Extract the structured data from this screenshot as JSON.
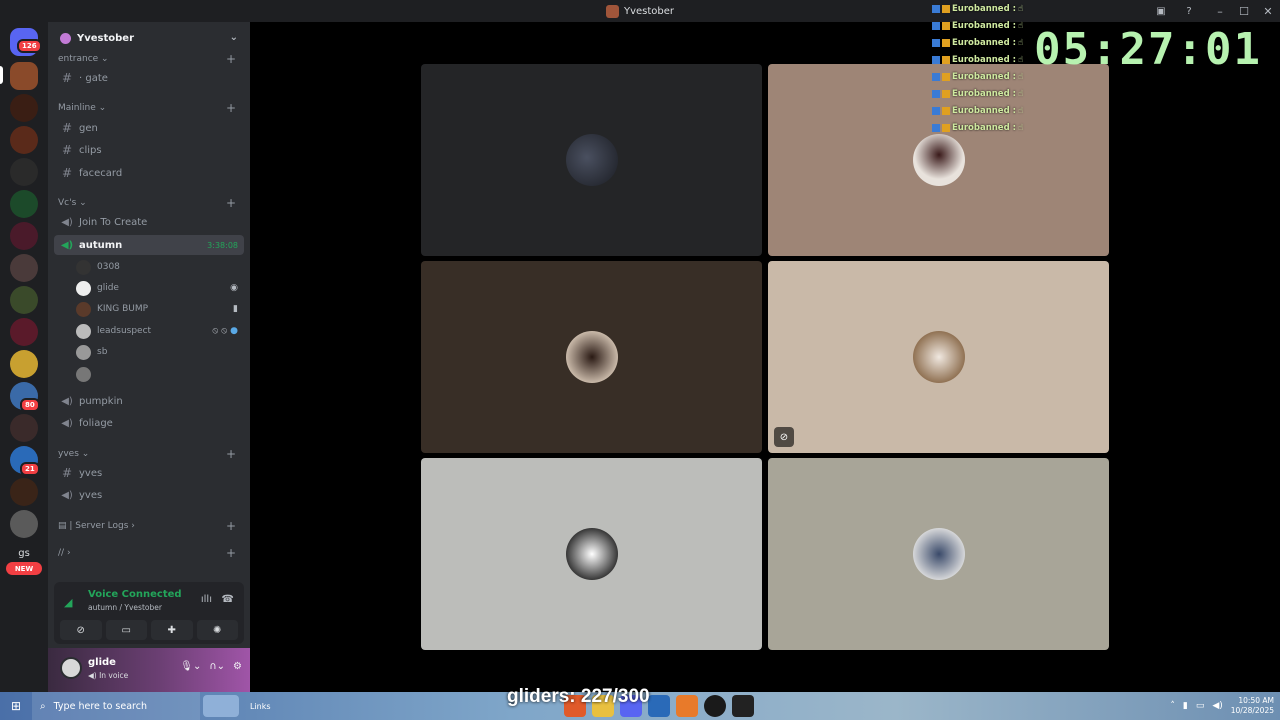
{
  "window": {
    "title": "Yvestober"
  },
  "rail": {
    "home_badge": "126",
    "badges": [
      "80",
      "21"
    ],
    "gs_label": "gs",
    "new_label": "NEW"
  },
  "guild": {
    "name": "Yvestober"
  },
  "categories": {
    "entrance": "entrance",
    "mainline": "Mainline",
    "vcs": "Vc's",
    "yves": "yves",
    "server_logs": "| Server Logs",
    "slashes": "//"
  },
  "channels": {
    "gate": "gate",
    "gen": "gen",
    "clips": "clips",
    "facecard": "facecard",
    "join_to_create": "Join To Create",
    "autumn": "autumn",
    "autumn_timer": "3:38:08",
    "pumpkin": "pumpkin",
    "foliage": "foliage",
    "yves_text": "yves",
    "yves_voice": "yves"
  },
  "voice_users": [
    "0308",
    "glide",
    "KING BUMP",
    "leadsuspect",
    "sb",
    ""
  ],
  "voice_panel": {
    "title": "Voice Connected",
    "subtitle": "autumn / Yvestober"
  },
  "user_panel": {
    "name": "glide",
    "status": "In voice"
  },
  "chat_overlay": {
    "name": "Eurobanned :",
    "lines": 8
  },
  "clock": "05:27:01",
  "gliders": "gliders: 227/300",
  "taskbar": {
    "search_placeholder": "Type here to search",
    "links": "Links",
    "time": "10:50 AM",
    "date": "10/28/2025"
  },
  "colors": {
    "accent_green": "#23a55a",
    "sidebar": "#2b2d31",
    "rail": "#1e1f22",
    "clock": "#b7f2b0"
  }
}
